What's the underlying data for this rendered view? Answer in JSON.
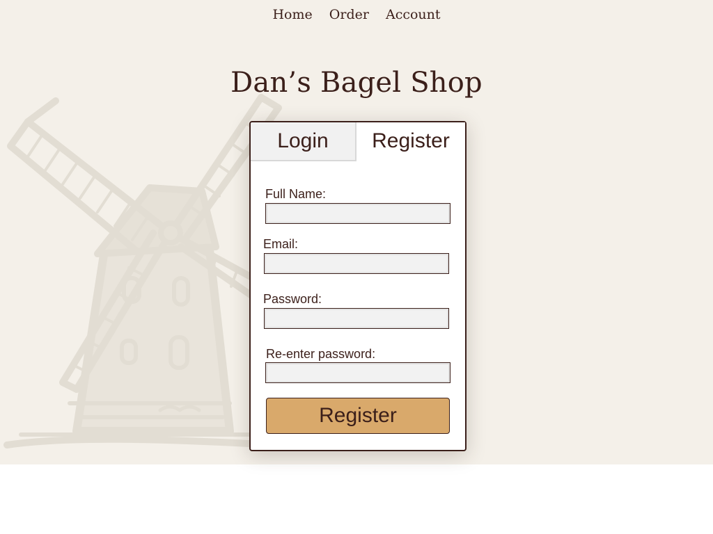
{
  "nav": {
    "items": [
      "Home",
      "Order",
      "Account"
    ]
  },
  "header": {
    "title": "Dan’s Bagel Shop"
  },
  "auth_card": {
    "tabs": [
      "Login",
      "Register"
    ],
    "active_tab": "Register",
    "fields": [
      {
        "label": "Full Name:",
        "value": ""
      },
      {
        "label": "Email:",
        "value": ""
      },
      {
        "label": "Password:",
        "value": ""
      },
      {
        "label": "Re-enter password:",
        "value": ""
      }
    ],
    "submit_label": "Register"
  },
  "colors": {
    "text": "#3b1f1a",
    "background": "#f4f0e9",
    "button": "#d9a96b",
    "input_fill": "#f2f2f2"
  },
  "decoration": {
    "background_icon": "windmill-icon"
  }
}
